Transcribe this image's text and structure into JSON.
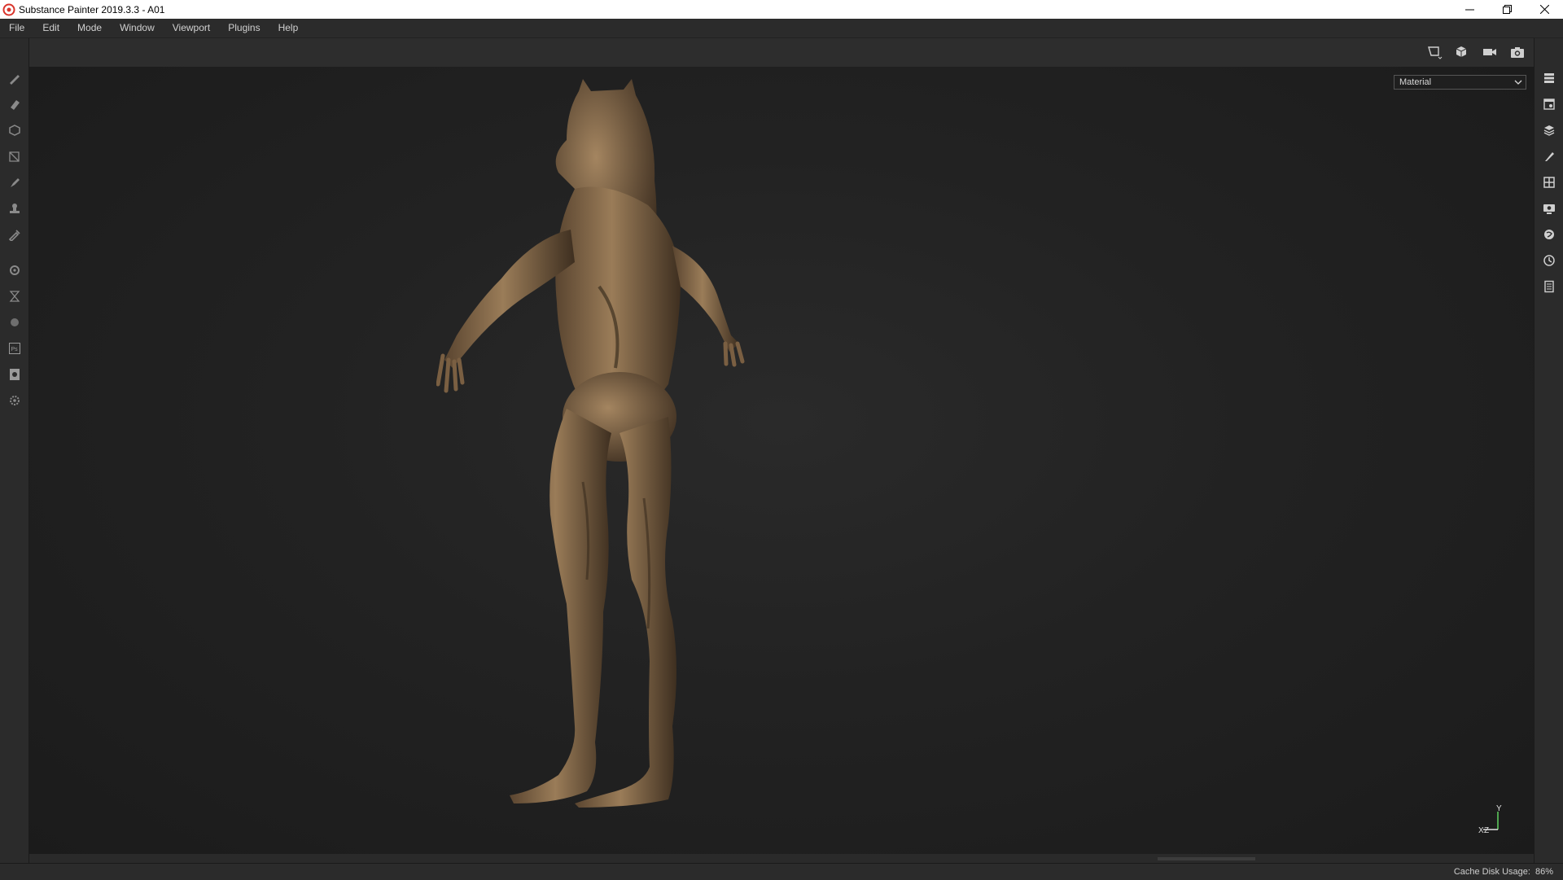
{
  "window": {
    "title": "Substance Painter 2019.3.3 - A01"
  },
  "menu": {
    "items": [
      "File",
      "Edit",
      "Mode",
      "Window",
      "Viewport",
      "Plugins",
      "Help"
    ]
  },
  "toolbar": {
    "right_icons": [
      "viewport-frame-icon",
      "3d-view-icon",
      "camera-icon",
      "screenshot-icon"
    ]
  },
  "left_tools": [
    "paint-brush-icon",
    "eraser-icon",
    "projection-icon",
    "polygon-fill-icon",
    "smudge-icon",
    "clone-stamp-icon",
    "color-picker-icon",
    "bake-settings-icon",
    "iray-icon",
    "material-icon",
    "photoshop-icon",
    "export-icon",
    "settings-icon"
  ],
  "right_panels": [
    "layers-panel-icon",
    "texture-set-icon",
    "stack-icon",
    "properties-icon",
    "uv-grid-icon",
    "display-settings-icon",
    "shader-icon",
    "history-icon",
    "log-icon"
  ],
  "viewport": {
    "channel_select": {
      "value": "Material"
    },
    "gizmo": {
      "y_label": "Y",
      "x_label": "X",
      "z_label": "Z"
    }
  },
  "status": {
    "cache_label": "Cache Disk Usage:",
    "cache_value": "86%"
  },
  "colors": {
    "model_bronze": "#8a6f4f",
    "ui_dark": "#2b2b2b",
    "viewport_bg": "#222222"
  }
}
